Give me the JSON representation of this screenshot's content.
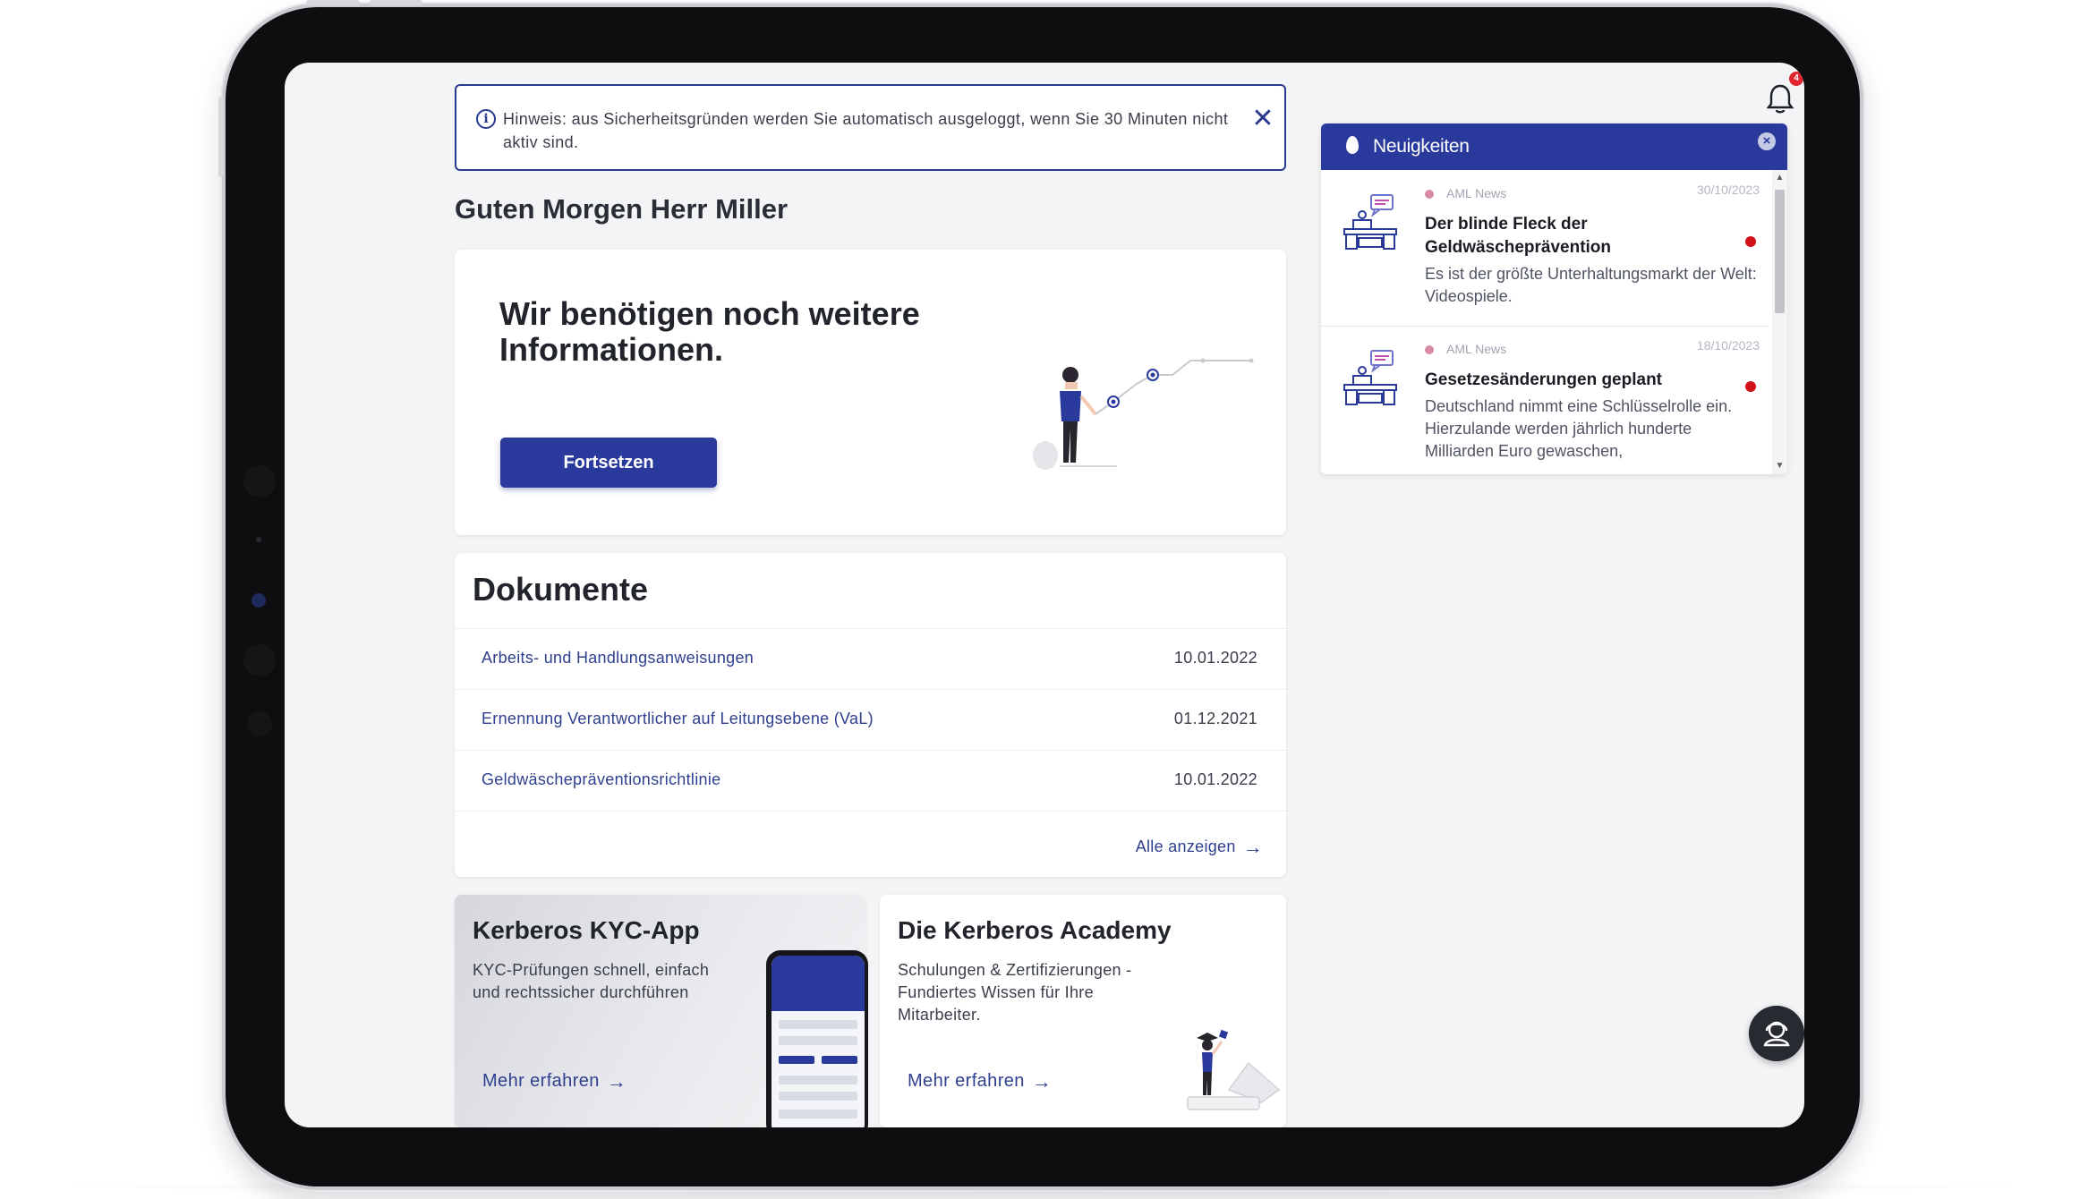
{
  "notice": {
    "text": "Hinweis: aus Sicherheitsgründen werden Sie automatisch ausgeloggt, wenn Sie 30 Minuten nicht aktiv sind.",
    "close_glyph": "✕"
  },
  "greeting": "Guten Morgen Herr Miller",
  "hero": {
    "headline": "Wir benötigen noch weitere Informationen.",
    "button_label": "Fortsetzen"
  },
  "documents": {
    "title": "Dokumente",
    "rows": [
      {
        "name": "Arbeits- und Handlungsanweisungen",
        "date": "10.01.2022"
      },
      {
        "name": "Ernennung Verantwortlicher auf Leitungsebene (VaL)",
        "date": "01.12.2021"
      },
      {
        "name": "Geldwäschepräventionsrichtlinie",
        "date": "10.01.2022"
      }
    ],
    "show_all": "Alle anzeigen",
    "arrow_glyph": "→"
  },
  "promos": {
    "kyc": {
      "title": "Kerberos KYC-App",
      "desc": "KYC-Prüfungen schnell, einfach und rechtssicher durchführen",
      "link": "Mehr erfahren"
    },
    "academy": {
      "title": "Die Kerberos Academy",
      "desc": "Schulungen & Zertifizierungen - Fundiertes Wissen für Ihre Mitarbeiter.",
      "link": "Mehr erfahren"
    }
  },
  "news": {
    "title": "Neuigkeiten",
    "close_glyph": "×",
    "items": [
      {
        "source": "AML News",
        "date": "30/10/2023",
        "title": "Der blinde Fleck der Geldwäscheprävention",
        "text": "Es ist der größte Unterhaltungsmarkt der Welt: Videospiele."
      },
      {
        "source": "AML News",
        "date": "18/10/2023",
        "title": "Gesetzesänderungen geplant",
        "text": "Deutschland nimmt eine Schlüsselrolle ein. Hierzulande werden jährlich hunderte Milliarden Euro gewaschen,"
      }
    ]
  },
  "notifications": {
    "badge": "4"
  },
  "colors": {
    "primary": "#2a3a9c",
    "link": "#2f3f8f",
    "unread": "#d2121a",
    "background": "#f3f4f6"
  },
  "icons": {
    "info": "info-icon",
    "close": "close-icon",
    "bell": "bell-icon",
    "flame": "flame-icon",
    "support": "support-agent-icon",
    "arrow": "arrow-right-icon"
  }
}
